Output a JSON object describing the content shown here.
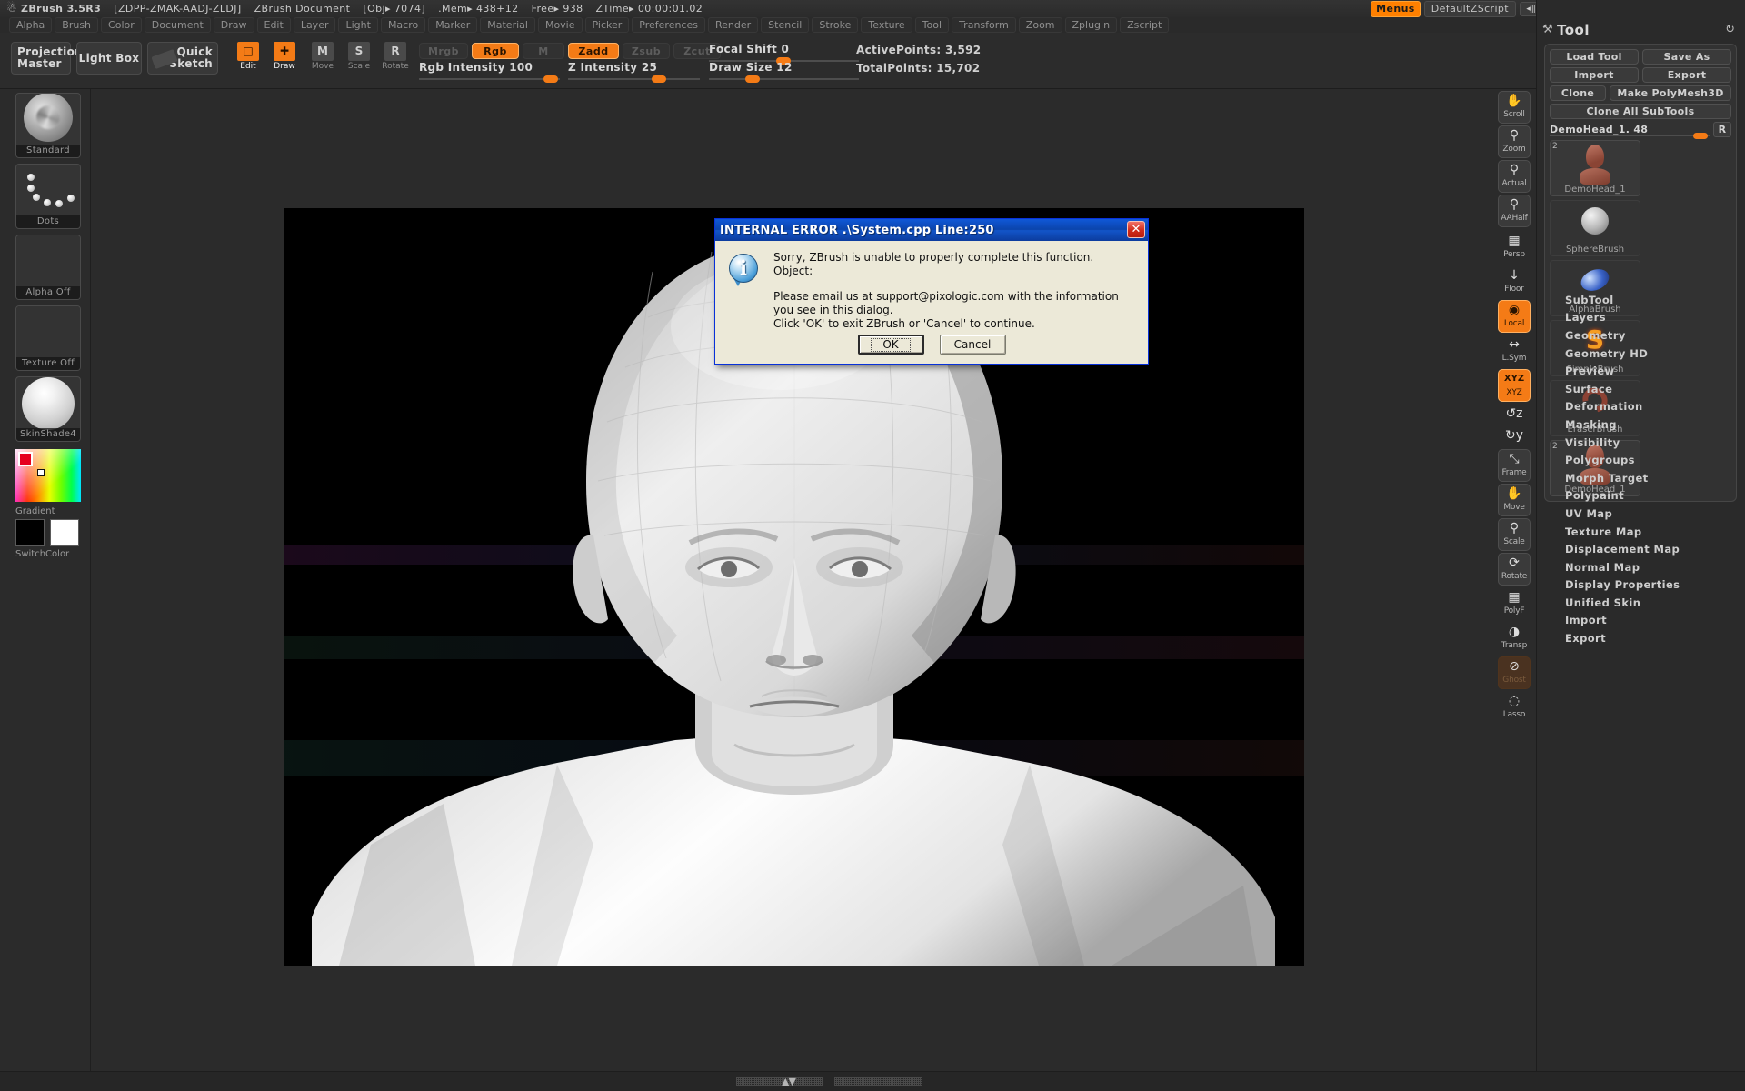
{
  "titlebar": {
    "app": "ZBrush 3.5R3",
    "license": "[ZDPP-ZMAK-AADJ-ZLDJ]",
    "document": "ZBrush Document",
    "obj": "[Obj▸ 7074]",
    "mem": ".Mem▸ 438+12",
    "free": "Free▸ 938",
    "ztime": "ZTime▸ 00:00:01.02",
    "logo_icon": "zbrush-logo-icon"
  },
  "topright": {
    "menus_label": "Menus",
    "zscript_label": "DefaultZScript",
    "prev_script": "◂|||",
    "next_script": "|||▸",
    "prev_layout": "◂❐",
    "next_layout": "❐▸",
    "lock_icon": "lock-icon",
    "minimize_icon": "minimize-icon",
    "restore_icon": "restore-icon",
    "close_icon": "close-icon"
  },
  "menubar": {
    "items": [
      "Alpha",
      "Brush",
      "Color",
      "Document",
      "Draw",
      "Edit",
      "Layer",
      "Light",
      "Macro",
      "Marker",
      "Material",
      "Movie",
      "Picker",
      "Preferences",
      "Render",
      "Stencil",
      "Stroke",
      "Texture",
      "Tool",
      "Transform",
      "Zoom",
      "Zplugin",
      "Zscript"
    ]
  },
  "toolbar": {
    "projection_master": "Projection\nMaster",
    "projection_master_line1": "Projection",
    "projection_master_line2": "Master",
    "light_box": "Light Box",
    "quick_sketch_line1": "Quick",
    "quick_sketch_line2": "Sketch",
    "quick_sketch_icon": "brush-icon",
    "edit": "Edit",
    "draw": "Draw",
    "move": "Move",
    "scale": "Scale",
    "rotate": "Rotate",
    "move_glyph": "M",
    "scale_glyph": "S",
    "rotate_glyph": "R",
    "mrgb": "Mrgb",
    "rgb": "Rgb",
    "m": "M",
    "zadd": "Zadd",
    "zsub": "Zsub",
    "zcut": "Zcut",
    "rgb_intensity": "Rgb Intensity 100",
    "z_intensity": "Z Intensity 25",
    "focal_shift": "Focal Shift 0",
    "draw_size": "Draw Size 12",
    "active_points": "ActivePoints: 3,592",
    "total_points": "TotalPoints: 15,702"
  },
  "left_palette": {
    "brush": {
      "label": "Standard",
      "icon": "standard-brush-icon"
    },
    "stroke": {
      "label": "Dots",
      "icon": "dots-stroke-icon"
    },
    "alpha": {
      "label": "Alpha Off",
      "icon": "alpha-off-icon"
    },
    "texture": {
      "label": "Texture Off",
      "icon": "texture-off-icon"
    },
    "material": {
      "label": "SkinShade4",
      "icon": "material-sphere-icon"
    },
    "gradient_label": "Gradient",
    "switchcolor_label": "SwitchColor",
    "main_color": "#e6001e",
    "secondary_color": "#ffffff",
    "primary_color": "#000000"
  },
  "right_strip": {
    "items": [
      {
        "label": "Scroll",
        "icon": "scroll-hand-icon",
        "state": "normal"
      },
      {
        "label": "Zoom",
        "icon": "zoom-magnifier-icon",
        "state": "normal"
      },
      {
        "label": "Actual",
        "icon": "actual-size-icon",
        "state": "normal"
      },
      {
        "label": "AAHalf",
        "icon": "aahalf-icon",
        "state": "normal"
      },
      {
        "label": "Persp",
        "icon": "perspective-grid-icon",
        "state": "flat"
      },
      {
        "label": "Floor",
        "icon": "floor-grid-icon",
        "state": "flat"
      },
      {
        "label": "Local",
        "icon": "local-pivot-icon",
        "state": "on"
      },
      {
        "label": "L.Sym",
        "icon": "local-symmetry-icon",
        "state": "flat"
      },
      {
        "label": "XYZ",
        "icon": "xyz-rotate-icon",
        "state": "on"
      },
      {
        "label": "",
        "icon": "rotate-z-icon",
        "state": "flat"
      },
      {
        "label": "",
        "icon": "rotate-y-icon",
        "state": "flat"
      },
      {
        "label": "Frame",
        "icon": "frame-icon",
        "state": "normal"
      },
      {
        "label": "Move",
        "icon": "move-hand-icon",
        "state": "normal"
      },
      {
        "label": "Scale",
        "icon": "scale-icon",
        "state": "normal"
      },
      {
        "label": "Rotate",
        "icon": "rotate-icon",
        "state": "normal"
      },
      {
        "label": "PolyF",
        "icon": "polyframe-icon",
        "state": "flat"
      },
      {
        "label": "Transp",
        "icon": "transparency-icon",
        "state": "flat"
      },
      {
        "label": "Ghost",
        "icon": "ghost-icon",
        "state": "dimmed"
      },
      {
        "label": "Lasso",
        "icon": "lasso-icon",
        "state": "flat"
      }
    ],
    "floor_axes": "X Y Z"
  },
  "tool_panel": {
    "title": "Tool",
    "title_icon": "tool-hammer-icon",
    "refresh_icon": "refresh-icon",
    "load_tool": "Load Tool",
    "save_as": "Save As",
    "import": "Import",
    "export": "Export",
    "clone": "Clone",
    "make_polymesh3d": "Make PolyMesh3D",
    "clone_all_subtools": "Clone All SubTools",
    "item_slider_label": "DemoHead_1. 48",
    "r_button": "R",
    "tiles": [
      {
        "label": "DemoHead_1",
        "icon": "demohead-bust-icon",
        "badge": "2",
        "selected": true
      },
      {
        "label": "SphereBrush",
        "icon": "sphere-brush-icon",
        "badge": "",
        "selected": false
      },
      {
        "label": "AlphaBrush",
        "icon": "alpha-brush-icon",
        "badge": "",
        "selected": false
      },
      {
        "label": "SimpleBrush",
        "icon": "simple-brush-icon",
        "badge": "",
        "selected": false
      },
      {
        "label": "EraserBrush",
        "icon": "eraser-brush-icon",
        "badge": "",
        "selected": false
      },
      {
        "label": "DemoHead_1",
        "icon": "demohead-bust-icon",
        "badge": "2",
        "selected": true
      }
    ],
    "menu_items": [
      "SubTool",
      "Layers",
      "Geometry",
      "Geometry HD",
      "Preview",
      "Surface",
      "Deformation",
      "Masking",
      "Visibility",
      "Polygroups",
      "Morph Target",
      "Polypaint",
      "UV Map",
      "Texture Map",
      "Displacement Map",
      "Normal Map",
      "Display Properties",
      "Unified Skin",
      "Import",
      "Export"
    ]
  },
  "dialog": {
    "title": "INTERNAL ERROR .\\System.cpp  Line:250",
    "close_icon": "close-icon",
    "info_icon": "info-icon",
    "line1": "Sorry, ZBrush is unable to properly complete this function.",
    "line2": "Object:",
    "line3": "Please email us at support@pixologic.com with the information you see in this dialog.",
    "line4": "Click 'OK' to exit ZBrush or 'Cancel' to continue.",
    "ok": "OK",
    "cancel": "Cancel",
    "titlebar_color": "#0b44ab",
    "body_color": "#ece9d8"
  },
  "bottom": {
    "scroll_up_icon": "scroll-up-icon",
    "scroll_down_icon": "scroll-down-icon"
  },
  "canvas": {
    "subject": "DemoHead_1 polygonal head bust sculpt, white/grey, dark background"
  }
}
